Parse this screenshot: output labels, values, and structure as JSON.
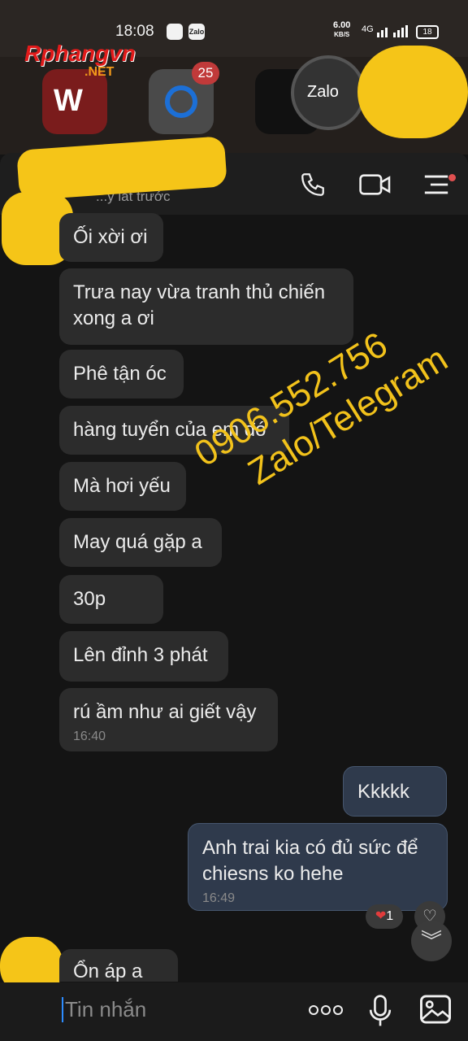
{
  "status_bar": {
    "time": "18:08",
    "net_speed_value": "6.00",
    "net_speed_unit": "KB/S",
    "network": "4G",
    "battery": "18"
  },
  "home": {
    "watermark_logo": "Rphangvn",
    "watermark_logo_tld": ".NET",
    "camera_badge": "25",
    "zalo_bubble_label": "Zalo"
  },
  "header": {
    "subtitle": "...y lát trước"
  },
  "messages": [
    {
      "text": "Ối xời ơi"
    },
    {
      "text": "Trưa nay vừa tranh thủ chiến xong a ơi"
    },
    {
      "text": "Phê tận óc"
    },
    {
      "text": "hàng tuyển của em đó"
    },
    {
      "text": "Mà hơi yếu"
    },
    {
      "text": "May quá gặp a"
    },
    {
      "text": "30p"
    },
    {
      "text": "Lên đỉnh 3 phát"
    },
    {
      "text": "rú ầm như ai giết vậy",
      "time": "16:40"
    }
  ],
  "outgoing": [
    {
      "text": "Kkkkk"
    },
    {
      "text": "Anh trai kia có đủ sức để chiesns ko hehe",
      "time": "16:49"
    }
  ],
  "reaction_count": "1",
  "last_message_partial": "Ổn áp a ơi",
  "watermark_text": {
    "line1": "0906.552.756",
    "line2": "Zalo/Telegram"
  },
  "input": {
    "placeholder": "Tin nhắn"
  },
  "colors": {
    "background": "#141414",
    "incoming_bubble": "#2c2c2c",
    "outgoing_bubble": "#2f3a4c",
    "watermark": "#f2c21b",
    "redact": "#f5c518"
  }
}
